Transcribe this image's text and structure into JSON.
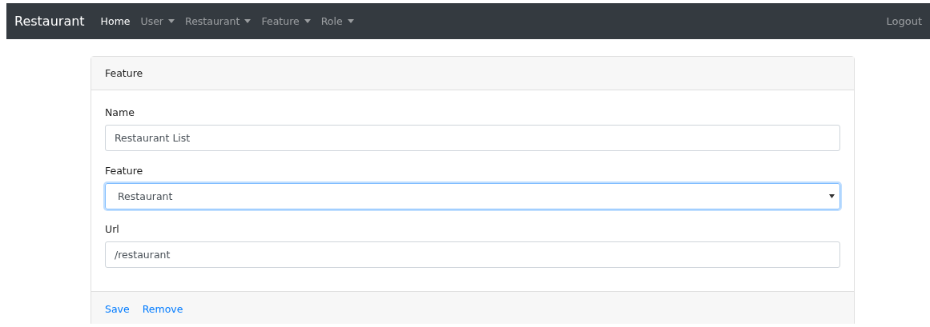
{
  "navbar": {
    "brand": "Restaurant",
    "items": [
      {
        "label": "Home",
        "selected": true,
        "dropdown": false
      },
      {
        "label": "User",
        "selected": false,
        "dropdown": true
      },
      {
        "label": "Restaurant",
        "selected": false,
        "dropdown": true
      },
      {
        "label": "Feature",
        "selected": false,
        "dropdown": true
      },
      {
        "label": "Role",
        "selected": false,
        "dropdown": true
      }
    ],
    "logout": "Logout"
  },
  "card": {
    "title": "Feature",
    "fields": [
      {
        "kind": "input",
        "label": "Name",
        "value": "Restaurant List",
        "focused": false
      },
      {
        "kind": "select",
        "label": "Feature",
        "value": "Restaurant",
        "focused": true
      },
      {
        "kind": "input",
        "label": "Url",
        "value": "/restaurant",
        "focused": false
      }
    ],
    "actions": [
      "Save",
      "Remove"
    ]
  }
}
